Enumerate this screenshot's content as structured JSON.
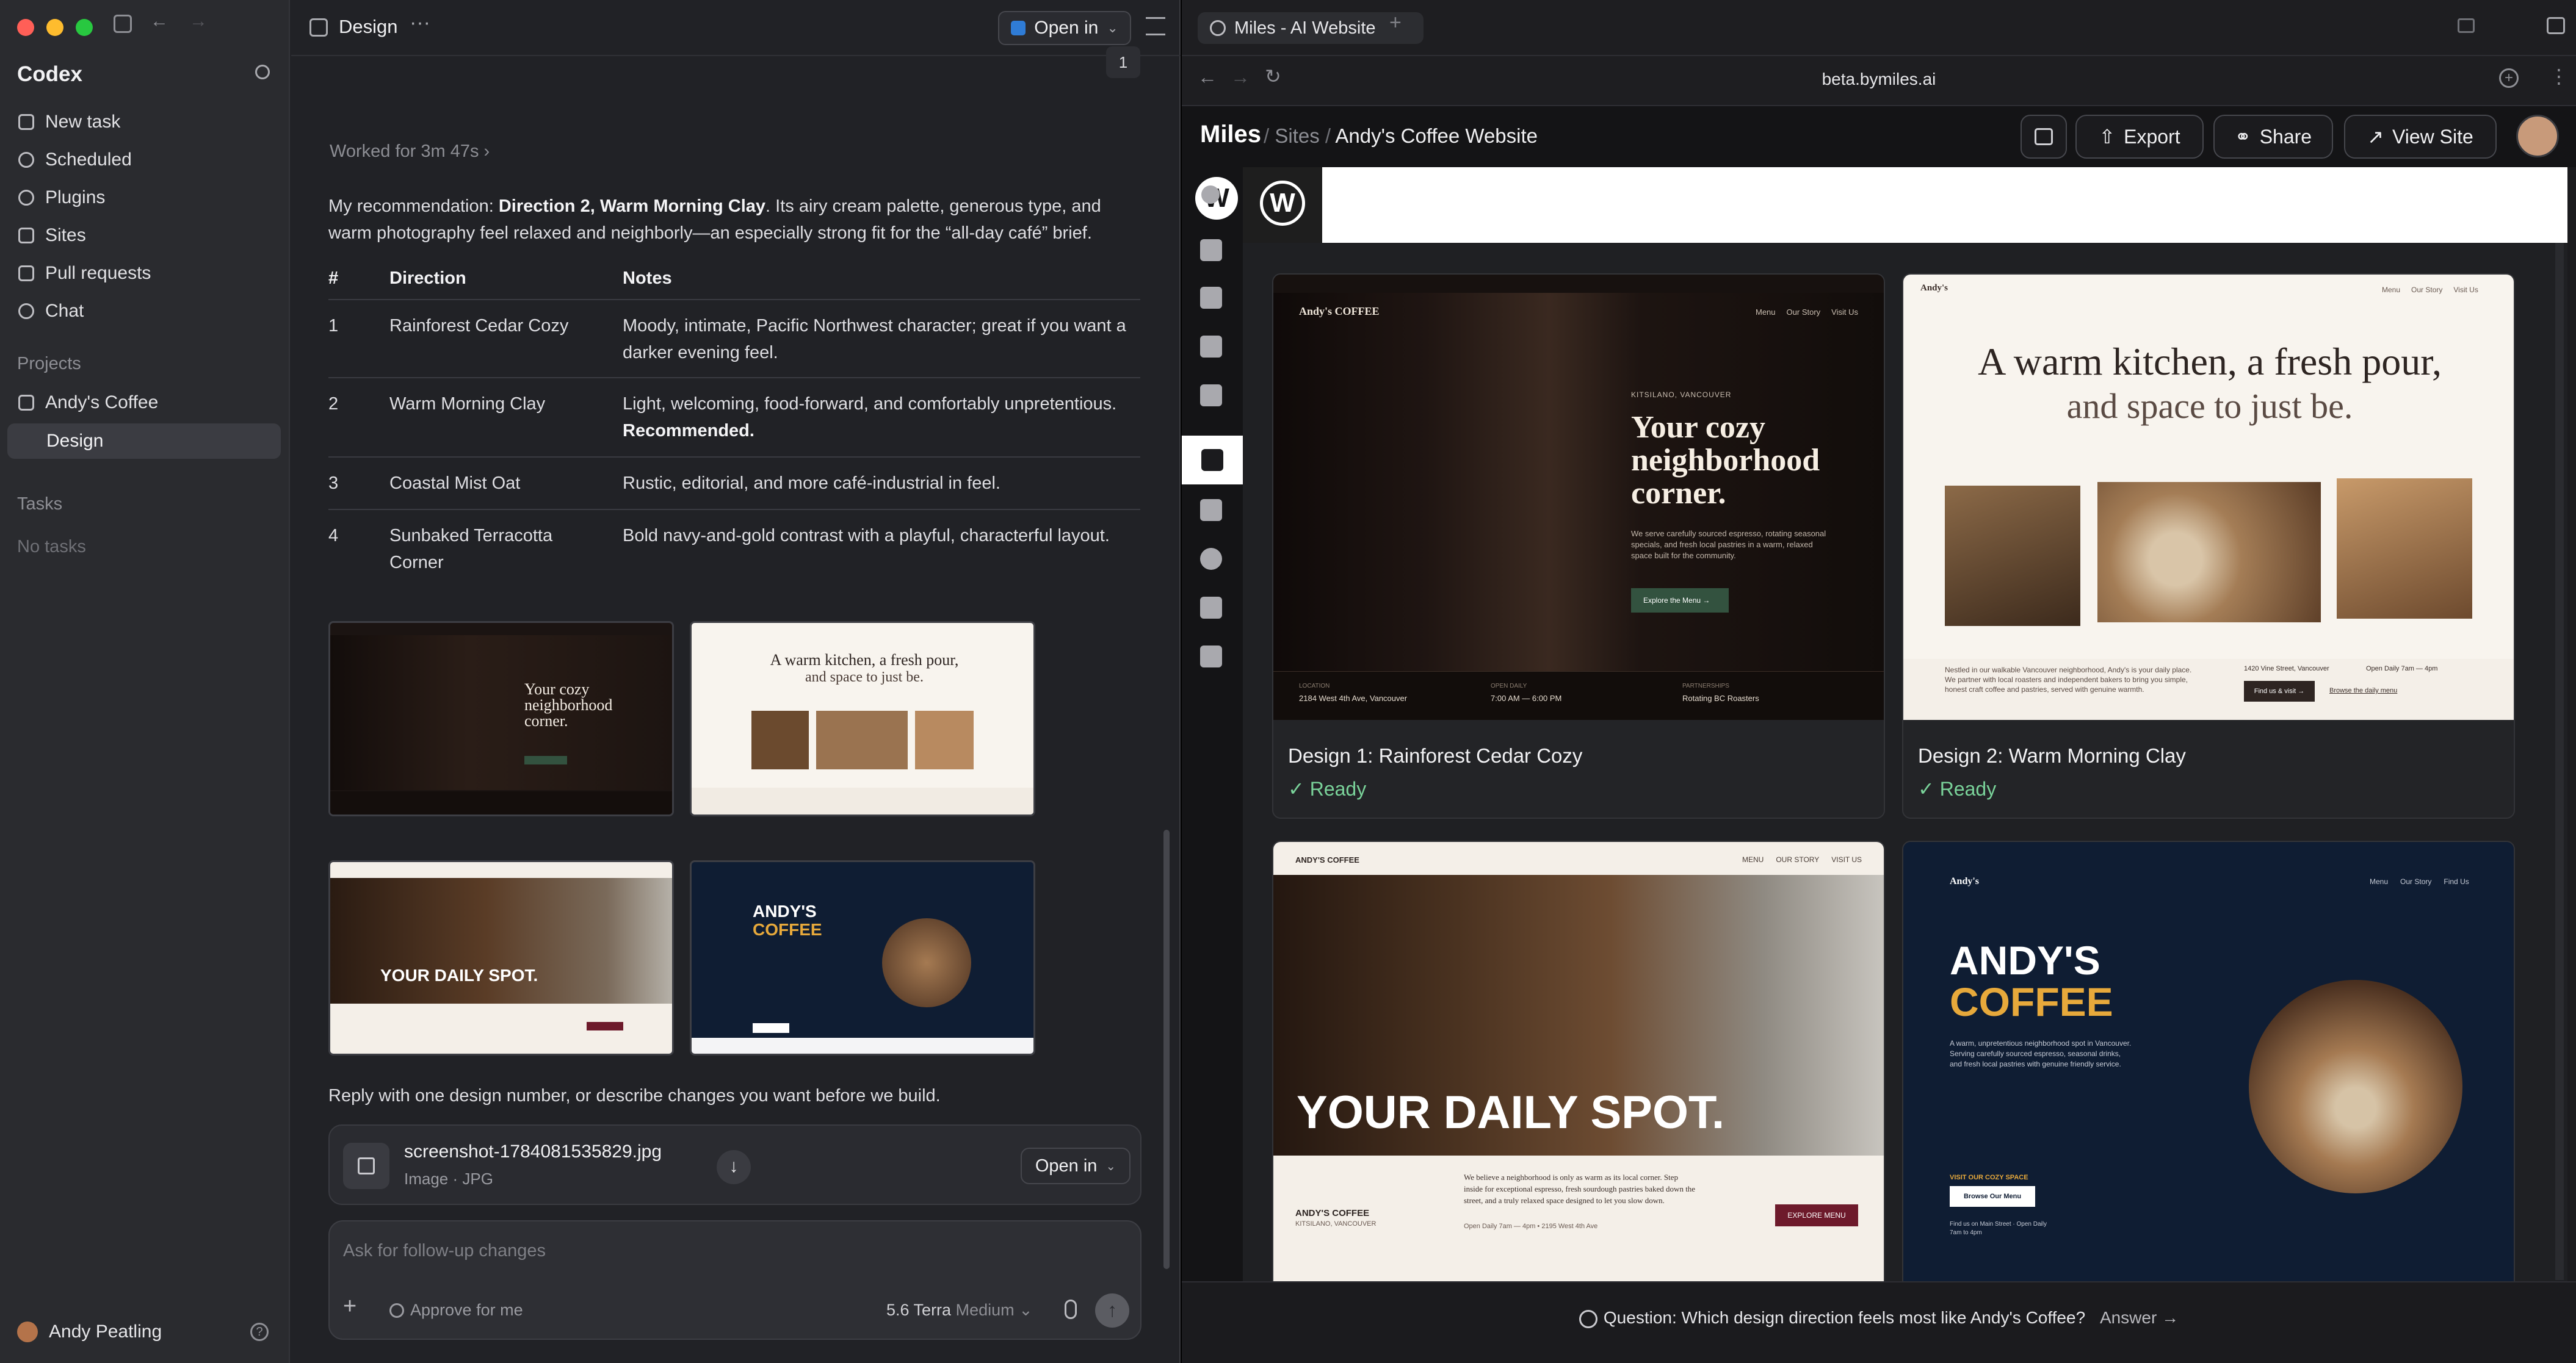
{
  "sidebar": {
    "app_name": "Codex",
    "nav": [
      {
        "label": "New task",
        "icon": "pencil-icon"
      },
      {
        "label": "Scheduled",
        "icon": "clock-icon"
      },
      {
        "label": "Plugins",
        "icon": "plug-icon"
      },
      {
        "label": "Sites",
        "icon": "browser-icon"
      },
      {
        "label": "Pull requests",
        "icon": "branch-icon"
      },
      {
        "label": "Chat",
        "icon": "plus-circle-icon"
      }
    ],
    "projects_heading": "Projects",
    "projects": [
      {
        "label": "Andy's Coffee",
        "icon": "folder-icon"
      },
      {
        "label": "Design"
      }
    ],
    "tasks_heading": "Tasks",
    "tasks_empty": "No tasks",
    "user": "Andy Peatling"
  },
  "main": {
    "title": "Design",
    "open_in": "Open in",
    "page_badge": "1",
    "worked_for": "Worked for 3m 47s",
    "recommendation_prefix": "My recommendation: ",
    "recommendation_bold": "Direction 2, Warm Morning Clay",
    "recommendation_rest": ". Its airy cream palette, generous type, and warm photography feel relaxed and neighborly—an especially strong fit for the “all-day café” brief.",
    "table": {
      "headers": [
        "#",
        "Direction",
        "Notes"
      ],
      "rows": [
        {
          "num": "1",
          "direction": "Rainforest Cedar Cozy",
          "notes": "Moody, intimate, Pacific Northwest character; great if you want a darker evening feel.",
          "notes_bold": ""
        },
        {
          "num": "2",
          "direction": "Warm Morning Clay",
          "notes": "Light, welcoming, food-forward, and comfortably unpretentious.",
          "notes_bold": "Recommended."
        },
        {
          "num": "3",
          "direction": "Coastal Mist Oat",
          "notes": "Rustic, editorial, and more café-industrial in feel.",
          "notes_bold": ""
        },
        {
          "num": "4",
          "direction": "Sunbaked Terracotta Corner",
          "notes": "Bold navy-and-gold contrast with a playful, characterful layout.",
          "notes_bold": ""
        }
      ]
    },
    "reply_prompt": "Reply with one design number, or describe changes you want before we build.",
    "attachment": {
      "name": "screenshot-1784081535829.jpg",
      "type": "Image · JPG",
      "open_in": "Open in"
    },
    "composer": {
      "placeholder": "Ask for follow-up changes",
      "approve": "Approve for me",
      "model": "5.6 Terra",
      "effort": "Medium"
    }
  },
  "browser": {
    "tab_title": "Miles - AI Website",
    "url": "beta.bymiles.ai",
    "brand": "Miles",
    "breadcrumb": [
      "Sites",
      "Andy's Coffee Website"
    ],
    "export": "Export",
    "share": "Share",
    "view_site": "View Site",
    "question": "Question: Which design direction feels most like Andy's Coffee?",
    "answer": "Answer →"
  },
  "designs": [
    {
      "label": "Design 1: Rainforest Cedar Cozy",
      "status": "Ready",
      "brand": "Andy's COFFEE",
      "nav": [
        "Menu",
        "Our Story",
        "Visit Us"
      ],
      "kicker": "KITSILANO, VANCOUVER",
      "headline": "Your cozy neighborhood corner.",
      "body": "We serve carefully sourced espresso, rotating seasonal specials, and fresh local pastries in a warm, relaxed space built for the community.",
      "cta": "Explore the Menu →",
      "footer": [
        {
          "k": "LOCATION",
          "v": "2184 West 4th Ave, Vancouver"
        },
        {
          "k": "OPEN DAILY",
          "v": "7:00 AM — 6:00 PM"
        },
        {
          "k": "PARTNERSHIPS",
          "v": "Rotating BC Roasters"
        }
      ]
    },
    {
      "label": "Design 2: Warm Morning Clay",
      "status": "Ready",
      "brand": "Andy's",
      "nav": [
        "Menu",
        "Our Story",
        "Visit Us"
      ],
      "headline_a": "A warm kitchen, a fresh pour,",
      "headline_b": "and space to just be.",
      "body": "Nestled in our walkable Vancouver neighborhood, Andy's is your daily place. We partner with local roasters and independent bakers to bring you simple, honest craft coffee and pastries, served with genuine warmth.",
      "address": "1420 Vine Street, Vancouver",
      "hours": "Open Daily 7am — 4pm",
      "cta": "Find us & visit →",
      "link": "Browse the daily menu"
    },
    {
      "brand": "ANDY'S COFFEE",
      "nav": [
        "MENU",
        "OUR STORY",
        "VISIT US"
      ],
      "headline": "YOUR DAILY SPOT.",
      "name": "ANDY'S COFFEE",
      "place": "KITSILANO, VANCOUVER",
      "body": "We believe a neighborhood is only as warm as its local corner. Step inside for exceptional espresso, fresh sourdough pastries baked down the street, and a truly relaxed space designed to let you slow down.",
      "meta": "Open Daily 7am — 4pm   •   2195 West 4th Ave",
      "cta": "EXPLORE MENU"
    },
    {
      "brand": "Andy's",
      "nav": [
        "Menu",
        "Our Story",
        "Find Us"
      ],
      "headline_a": "ANDY'S",
      "headline_b": "COFFEE",
      "body": "A warm, unpretentious neighborhood spot in Vancouver. Serving carefully sourced espresso, seasonal drinks, and fresh local pastries with genuine friendly service.",
      "kicker": "VISIT OUR COZY SPACE",
      "cta": "Browse Our Menu",
      "foot": "Find us on Main Street · Open Daily 7am to 4pm"
    }
  ],
  "colors": {
    "accent_green": "#7ad39a",
    "cream": "#f6f1ea",
    "navy": "#0f1d33",
    "gold": "#e7a93b",
    "maroon": "#6d1a2b"
  }
}
